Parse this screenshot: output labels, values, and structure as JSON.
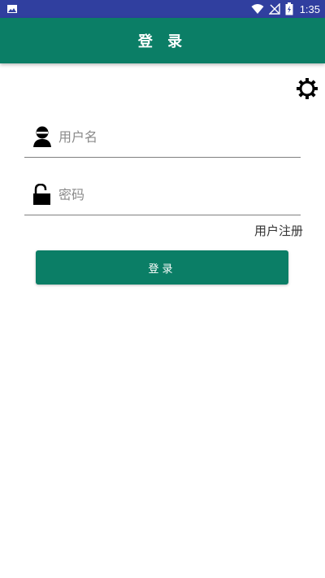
{
  "status_bar": {
    "time": "1:35",
    "icons": [
      "image-icon",
      "wifi-icon",
      "signal-off-icon",
      "battery-charging-icon"
    ]
  },
  "app_bar": {
    "title": "登 录"
  },
  "settings": {
    "icon": "gear-icon"
  },
  "form": {
    "username": {
      "value": "",
      "placeholder": "用户名",
      "icon": "user-icon"
    },
    "password": {
      "value": "",
      "placeholder": "密码",
      "icon": "lock-open-icon"
    },
    "register_label": "用户注册",
    "login_label": "登录"
  },
  "colors": {
    "status_bar": "#303f9f",
    "primary": "#0b7e66",
    "background": "#ffffff"
  }
}
